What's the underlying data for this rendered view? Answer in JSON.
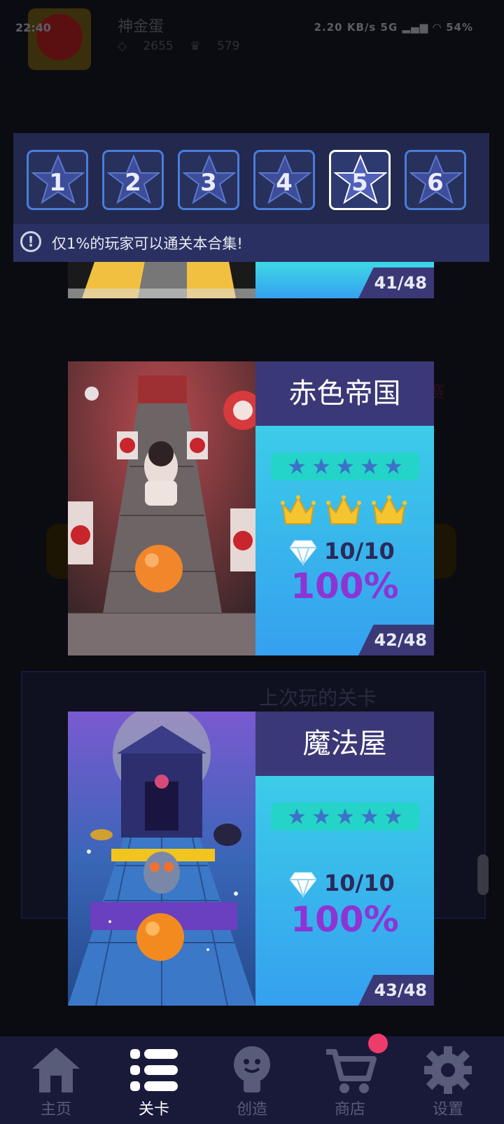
{
  "status_bar": {
    "time": "22:40",
    "right_text": "2.20 KB/s  5G  54%",
    "battery": "54%"
  },
  "profile": {
    "name": "神金蛋",
    "gems": "2655",
    "crowns": "579"
  },
  "background": {
    "last_played_title": "上次玩的关卡",
    "contest_label": "赛"
  },
  "level_selector": {
    "tiles": [
      "1",
      "2",
      "3",
      "4",
      "5",
      "6"
    ],
    "selected": "5",
    "notice": "仅1%的玩家可以通关本合集!"
  },
  "cards": [
    {
      "title": "",
      "counter": "41/48"
    },
    {
      "title": "赤色帝国",
      "stars": 5,
      "crowns": 3,
      "gems": "10/10",
      "percent": "100%",
      "counter": "42/48"
    },
    {
      "title": "魔法屋",
      "stars": 5,
      "crowns": 0,
      "gems": "10/10",
      "percent": "100%",
      "counter": "43/48"
    }
  ],
  "nav": {
    "items": [
      {
        "label": "主页",
        "icon": "home-icon"
      },
      {
        "label": "关卡",
        "icon": "list-icon",
        "active": true
      },
      {
        "label": "创造",
        "icon": "lightbulb-icon"
      },
      {
        "label": "商店",
        "icon": "cart-icon"
      },
      {
        "label": "设置",
        "icon": "gear-icon"
      }
    ]
  },
  "colors": {
    "selector_bg": "#22284e",
    "card_title_bg": "#3b3877",
    "percent": "#8d35d4",
    "nav_bg": "#191a3a",
    "badge": "#ee3c6a"
  }
}
